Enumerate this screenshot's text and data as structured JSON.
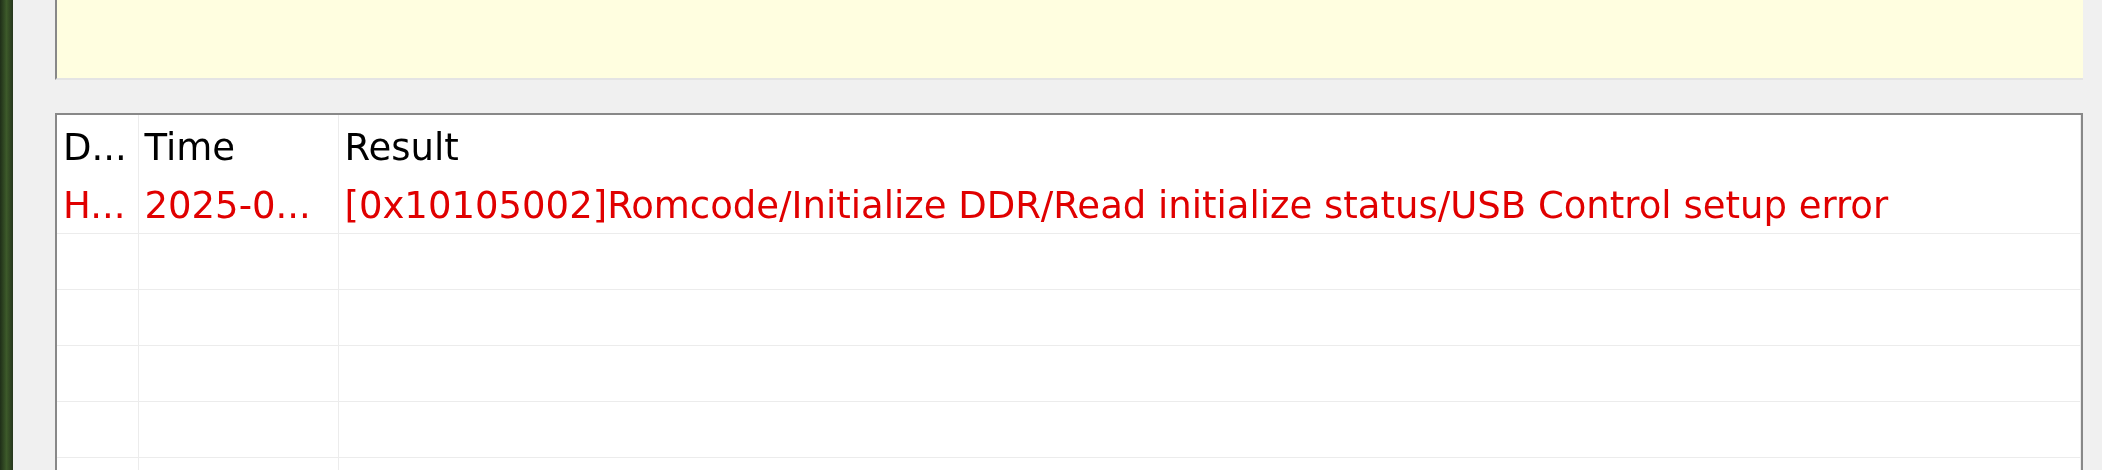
{
  "table": {
    "columns": [
      "D...",
      "Time",
      "Result"
    ],
    "rows": [
      {
        "kind": "error",
        "cells": [
          "H...",
          "2025-0...",
          "[0x10105002]Romcode/Initialize DDR/Read initialize status/USB Control setup error"
        ]
      }
    ]
  }
}
